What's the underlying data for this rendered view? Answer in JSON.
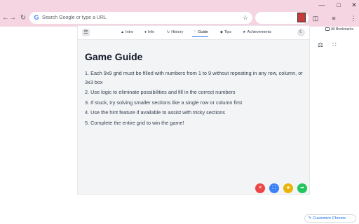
{
  "browser": {
    "omnibox_placeholder": "Search Google or type a URL",
    "bookmarks_label": "All Bookmarks",
    "customize_label": "Customize Chrome"
  },
  "nav": {
    "tabs": [
      {
        "label": "Intro",
        "icon": "rocket-icon"
      },
      {
        "label": "Info",
        "icon": "info-icon"
      },
      {
        "label": "History",
        "icon": "history-icon"
      },
      {
        "label": "Guide",
        "icon": "question-icon"
      },
      {
        "label": "Tips",
        "icon": "lightbulb-icon"
      },
      {
        "label": "Achievements",
        "icon": "trophy-icon"
      }
    ],
    "active_tab": "Guide"
  },
  "guide": {
    "title": "Game Guide",
    "items": [
      "1. Each 9x9 grid must be filled with numbers from 1 to 9 without repeating in any row, column, or 3x3 box",
      "2. Use logic to eliminate possibilities and fill in the correct numbers",
      "3. If stuck, try solving smaller sections like a single row or column first",
      "4. Use the hint feature if available to assist with tricky sections",
      "5. Complete the entire grid to win the game!"
    ]
  },
  "fabs": [
    {
      "name": "close",
      "color": "#ef4444"
    },
    {
      "name": "fullscreen",
      "color": "#3b82f6"
    },
    {
      "name": "favorite",
      "color": "#eab308"
    },
    {
      "name": "share",
      "color": "#22c55e"
    }
  ],
  "colors": {
    "chrome_frame": "#f6d5e3",
    "accent": "#3b82f6"
  }
}
